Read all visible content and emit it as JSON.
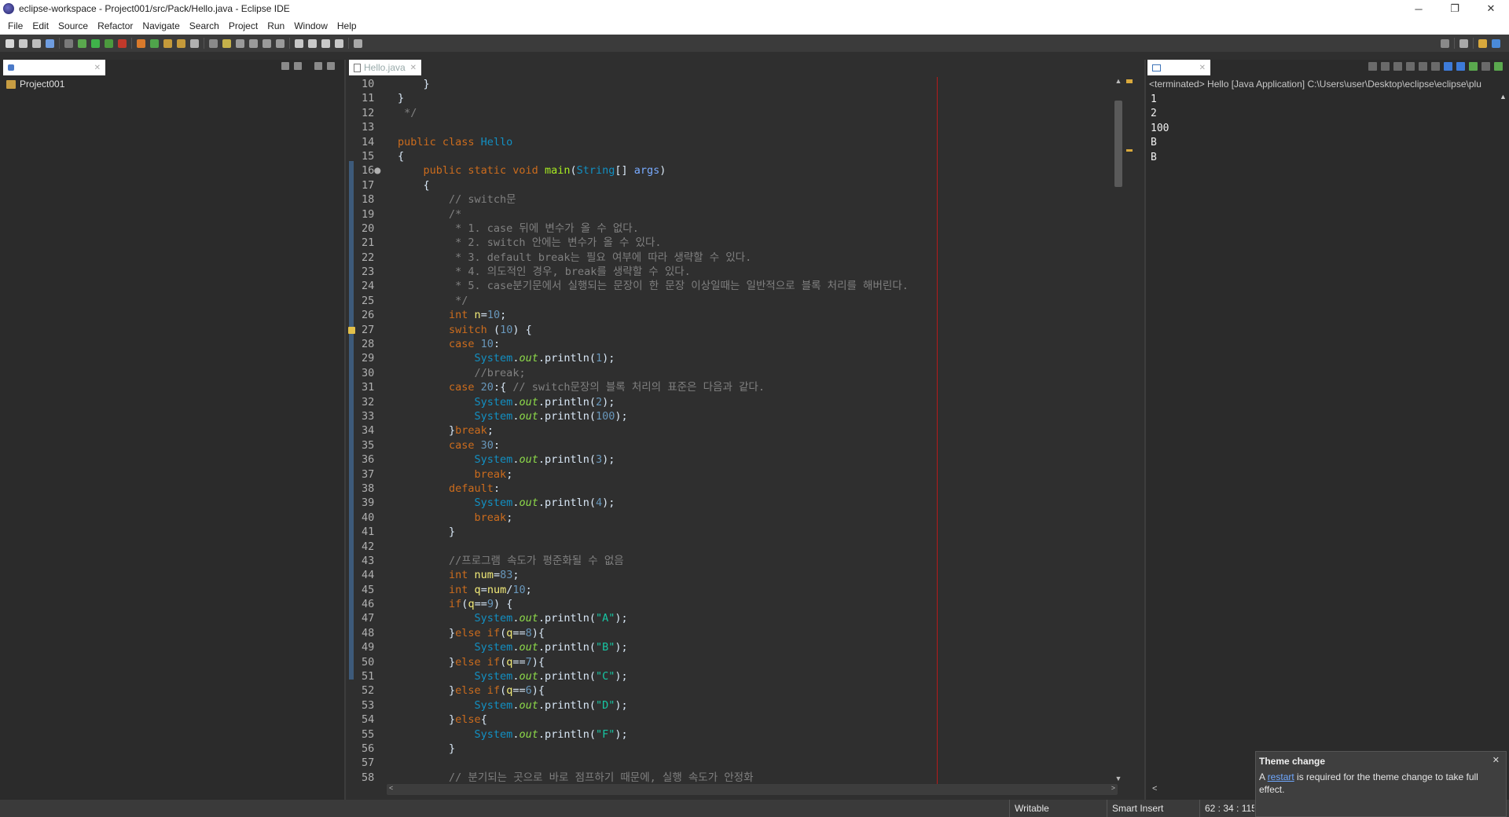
{
  "window": {
    "title": "eclipse-workspace - Project001/src/Pack/Hello.java - Eclipse IDE",
    "controls": {
      "minimize": "─",
      "restore": "❐",
      "close": "✕"
    }
  },
  "menu": [
    "File",
    "Edit",
    "Source",
    "Refactor",
    "Navigate",
    "Search",
    "Project",
    "Run",
    "Window",
    "Help"
  ],
  "explorer": {
    "tab_close": "✕",
    "tree": [
      {
        "label": "Project001"
      }
    ]
  },
  "editor": {
    "tab_label": "Hello.java",
    "tab_close": "✕",
    "hscroll_left": "<",
    "hscroll_right": ">",
    "vscroll_up": "▲",
    "vscroll_down": "▼",
    "lines": [
      {
        "n": "10",
        "indent": "    ",
        "tokens": [
          [
            "plain",
            "}"
          ]
        ]
      },
      {
        "n": "11",
        "indent": "",
        "tokens": [
          [
            "plain",
            "}"
          ]
        ]
      },
      {
        "n": "12",
        "indent": " ",
        "tokens": [
          [
            "cmt",
            "*/"
          ]
        ]
      },
      {
        "n": "13",
        "indent": "",
        "tokens": []
      },
      {
        "n": "14",
        "indent": "",
        "tokens": [
          [
            "kw",
            "public class "
          ],
          [
            "cls",
            "Hello"
          ]
        ]
      },
      {
        "n": "15",
        "indent": "",
        "tokens": [
          [
            "plain",
            "{"
          ]
        ]
      },
      {
        "n": "16●",
        "indent": "    ",
        "tokens": [
          [
            "kw",
            "public static void "
          ],
          [
            "mth",
            "main"
          ],
          [
            "plain",
            "("
          ],
          [
            "cls",
            "String"
          ],
          [
            "plain",
            "[] "
          ],
          [
            "par",
            "args"
          ],
          [
            "plain",
            ")"
          ]
        ]
      },
      {
        "n": "17",
        "indent": "    ",
        "tokens": [
          [
            "plain",
            "{"
          ]
        ]
      },
      {
        "n": "18",
        "indent": "        ",
        "tokens": [
          [
            "cmt",
            "// switch문"
          ]
        ]
      },
      {
        "n": "19",
        "indent": "        ",
        "tokens": [
          [
            "cmt",
            "/*"
          ]
        ]
      },
      {
        "n": "20",
        "indent": "         ",
        "tokens": [
          [
            "cmt",
            "* 1. case 뒤에 변수가 올 수 없다."
          ]
        ]
      },
      {
        "n": "21",
        "indent": "         ",
        "tokens": [
          [
            "cmt",
            "* 2. switch 안에는 변수가 올 수 있다."
          ]
        ]
      },
      {
        "n": "22",
        "indent": "         ",
        "tokens": [
          [
            "cmt",
            "* 3. default break는 필요 여부에 따라 생략할 수 있다."
          ]
        ]
      },
      {
        "n": "23",
        "indent": "         ",
        "tokens": [
          [
            "cmt",
            "* 4. 의도적인 경우, break를 생략할 수 있다."
          ]
        ]
      },
      {
        "n": "24",
        "indent": "         ",
        "tokens": [
          [
            "cmt",
            "* 5. case분기문에서 실행되는 문장이 한 문장 이상일때는 일반적으로 블록 처리를 해버린다."
          ]
        ]
      },
      {
        "n": "25",
        "indent": "         ",
        "tokens": [
          [
            "cmt",
            "*/"
          ]
        ]
      },
      {
        "n": "26",
        "indent": "        ",
        "tokens": [
          [
            "kw",
            "int "
          ],
          [
            "var",
            "n"
          ],
          [
            "plain",
            "="
          ],
          [
            "num",
            "10"
          ],
          [
            "plain",
            ";"
          ]
        ]
      },
      {
        "n": "27",
        "indent": "        ",
        "tokens": [
          [
            "kw",
            "switch "
          ],
          [
            "plain",
            "("
          ],
          [
            "num",
            "10"
          ],
          [
            "plain",
            ") {"
          ]
        ]
      },
      {
        "n": "28",
        "indent": "        ",
        "tokens": [
          [
            "kw",
            "case "
          ],
          [
            "num",
            "10"
          ],
          [
            "plain",
            ":"
          ]
        ]
      },
      {
        "n": "29",
        "indent": "            ",
        "tokens": [
          [
            "cls",
            "System"
          ],
          [
            "plain",
            "."
          ],
          [
            "fld",
            "out"
          ],
          [
            "plain",
            ".println("
          ],
          [
            "num",
            "1"
          ],
          [
            "plain",
            ");"
          ]
        ]
      },
      {
        "n": "30",
        "indent": "            ",
        "tokens": [
          [
            "cmt",
            "//break;"
          ]
        ]
      },
      {
        "n": "31",
        "indent": "        ",
        "tokens": [
          [
            "kw",
            "case "
          ],
          [
            "num",
            "20"
          ],
          [
            "plain",
            ":{ "
          ],
          [
            "cmt",
            "// switch문장의 블록 처리의 표준은 다음과 같다."
          ]
        ]
      },
      {
        "n": "32",
        "indent": "            ",
        "tokens": [
          [
            "cls",
            "System"
          ],
          [
            "plain",
            "."
          ],
          [
            "fld",
            "out"
          ],
          [
            "plain",
            ".println("
          ],
          [
            "num",
            "2"
          ],
          [
            "plain",
            ");"
          ]
        ]
      },
      {
        "n": "33",
        "indent": "            ",
        "tokens": [
          [
            "cls",
            "System"
          ],
          [
            "plain",
            "."
          ],
          [
            "fld",
            "out"
          ],
          [
            "plain",
            ".println("
          ],
          [
            "num",
            "100"
          ],
          [
            "plain",
            ");"
          ]
        ]
      },
      {
        "n": "34",
        "indent": "        ",
        "tokens": [
          [
            "plain",
            "}"
          ],
          [
            "kw",
            "break"
          ],
          [
            "plain",
            ";"
          ]
        ]
      },
      {
        "n": "35",
        "indent": "        ",
        "tokens": [
          [
            "kw",
            "case "
          ],
          [
            "num",
            "30"
          ],
          [
            "plain",
            ":"
          ]
        ]
      },
      {
        "n": "36",
        "indent": "            ",
        "tokens": [
          [
            "cls",
            "System"
          ],
          [
            "plain",
            "."
          ],
          [
            "fld",
            "out"
          ],
          [
            "plain",
            ".println("
          ],
          [
            "num",
            "3"
          ],
          [
            "plain",
            ");"
          ]
        ]
      },
      {
        "n": "37",
        "indent": "            ",
        "tokens": [
          [
            "kw",
            "break"
          ],
          [
            "plain",
            ";"
          ]
        ]
      },
      {
        "n": "38",
        "indent": "        ",
        "tokens": [
          [
            "kw",
            "default"
          ],
          [
            "plain",
            ":"
          ]
        ]
      },
      {
        "n": "39",
        "indent": "            ",
        "tokens": [
          [
            "cls",
            "System"
          ],
          [
            "plain",
            "."
          ],
          [
            "fld",
            "out"
          ],
          [
            "plain",
            ".println("
          ],
          [
            "num",
            "4"
          ],
          [
            "plain",
            ");"
          ]
        ]
      },
      {
        "n": "40",
        "indent": "            ",
        "tokens": [
          [
            "kw",
            "break"
          ],
          [
            "plain",
            ";"
          ]
        ]
      },
      {
        "n": "41",
        "indent": "        ",
        "tokens": [
          [
            "plain",
            "}"
          ]
        ]
      },
      {
        "n": "42",
        "indent": "",
        "tokens": []
      },
      {
        "n": "43",
        "indent": "        ",
        "tokens": [
          [
            "cmt",
            "//프로그램 속도가 평준화될 수 없음"
          ]
        ]
      },
      {
        "n": "44",
        "indent": "        ",
        "tokens": [
          [
            "kw",
            "int "
          ],
          [
            "var",
            "num"
          ],
          [
            "plain",
            "="
          ],
          [
            "num",
            "83"
          ],
          [
            "plain",
            ";"
          ]
        ]
      },
      {
        "n": "45",
        "indent": "        ",
        "tokens": [
          [
            "kw",
            "int "
          ],
          [
            "var",
            "q"
          ],
          [
            "plain",
            "="
          ],
          [
            "var",
            "num"
          ],
          [
            "plain",
            "/"
          ],
          [
            "num",
            "10"
          ],
          [
            "plain",
            ";"
          ]
        ]
      },
      {
        "n": "46",
        "indent": "        ",
        "tokens": [
          [
            "kw",
            "if"
          ],
          [
            "plain",
            "("
          ],
          [
            "var",
            "q"
          ],
          [
            "plain",
            "=="
          ],
          [
            "num",
            "9"
          ],
          [
            "plain",
            ") {"
          ]
        ]
      },
      {
        "n": "47",
        "indent": "            ",
        "tokens": [
          [
            "cls",
            "System"
          ],
          [
            "plain",
            "."
          ],
          [
            "fld",
            "out"
          ],
          [
            "plain",
            ".println("
          ],
          [
            "str",
            "\"A\""
          ],
          [
            "plain",
            ");"
          ]
        ]
      },
      {
        "n": "48",
        "indent": "        ",
        "tokens": [
          [
            "plain",
            "}"
          ],
          [
            "kw",
            "else if"
          ],
          [
            "plain",
            "("
          ],
          [
            "var",
            "q"
          ],
          [
            "plain",
            "=="
          ],
          [
            "num",
            "8"
          ],
          [
            "plain",
            "){"
          ]
        ]
      },
      {
        "n": "49",
        "indent": "            ",
        "tokens": [
          [
            "cls",
            "System"
          ],
          [
            "plain",
            "."
          ],
          [
            "fld",
            "out"
          ],
          [
            "plain",
            ".println("
          ],
          [
            "str",
            "\"B\""
          ],
          [
            "plain",
            ");"
          ]
        ]
      },
      {
        "n": "50",
        "indent": "        ",
        "tokens": [
          [
            "plain",
            "}"
          ],
          [
            "kw",
            "else if"
          ],
          [
            "plain",
            "("
          ],
          [
            "var",
            "q"
          ],
          [
            "plain",
            "=="
          ],
          [
            "num",
            "7"
          ],
          [
            "plain",
            "){"
          ]
        ]
      },
      {
        "n": "51",
        "indent": "            ",
        "tokens": [
          [
            "cls",
            "System"
          ],
          [
            "plain",
            "."
          ],
          [
            "fld",
            "out"
          ],
          [
            "plain",
            ".println("
          ],
          [
            "str",
            "\"C\""
          ],
          [
            "plain",
            ");"
          ]
        ]
      },
      {
        "n": "52",
        "indent": "        ",
        "tokens": [
          [
            "plain",
            "}"
          ],
          [
            "kw",
            "else if"
          ],
          [
            "plain",
            "("
          ],
          [
            "var",
            "q"
          ],
          [
            "plain",
            "=="
          ],
          [
            "num",
            "6"
          ],
          [
            "plain",
            "){"
          ]
        ]
      },
      {
        "n": "53",
        "indent": "            ",
        "tokens": [
          [
            "cls",
            "System"
          ],
          [
            "plain",
            "."
          ],
          [
            "fld",
            "out"
          ],
          [
            "plain",
            ".println("
          ],
          [
            "str",
            "\"D\""
          ],
          [
            "plain",
            ");"
          ]
        ]
      },
      {
        "n": "54",
        "indent": "        ",
        "tokens": [
          [
            "plain",
            "}"
          ],
          [
            "kw",
            "else"
          ],
          [
            "plain",
            "{"
          ]
        ]
      },
      {
        "n": "55",
        "indent": "            ",
        "tokens": [
          [
            "cls",
            "System"
          ],
          [
            "plain",
            "."
          ],
          [
            "fld",
            "out"
          ],
          [
            "plain",
            ".println("
          ],
          [
            "str",
            "\"F\""
          ],
          [
            "plain",
            ");"
          ]
        ]
      },
      {
        "n": "56",
        "indent": "        ",
        "tokens": [
          [
            "plain",
            "}"
          ]
        ]
      },
      {
        "n": "57",
        "indent": "",
        "tokens": []
      },
      {
        "n": "58",
        "indent": "        ",
        "tokens": [
          [
            "cmt",
            "// 분기되는 곳으로 바로 점프하기 때문에, 실행 속도가 안정화"
          ]
        ]
      }
    ]
  },
  "console": {
    "tab_close": "✕",
    "terminated_line": "<terminated> Hello [Java Application] C:\\Users\\user\\Desktop\\eclipse\\eclipse\\plu",
    "output": [
      "1",
      "2",
      "100",
      "B",
      "B"
    ],
    "scroll_up": "▲",
    "scroll_left": "<"
  },
  "statusbar": {
    "writable": "Writable",
    "insert_mode": "Smart Insert",
    "position": "62 : 34 : 115"
  },
  "notification": {
    "title": "Theme change",
    "close": "✕",
    "msg_before": "A ",
    "link": "restart",
    "msg_after": " is required for the theme change to take full effect."
  },
  "colors": {
    "keyword": "#cc6c1d",
    "class": "#1290c3",
    "method": "#a7ec21",
    "number": "#6897bb",
    "string": "#17c6a3",
    "comment": "#808080"
  }
}
